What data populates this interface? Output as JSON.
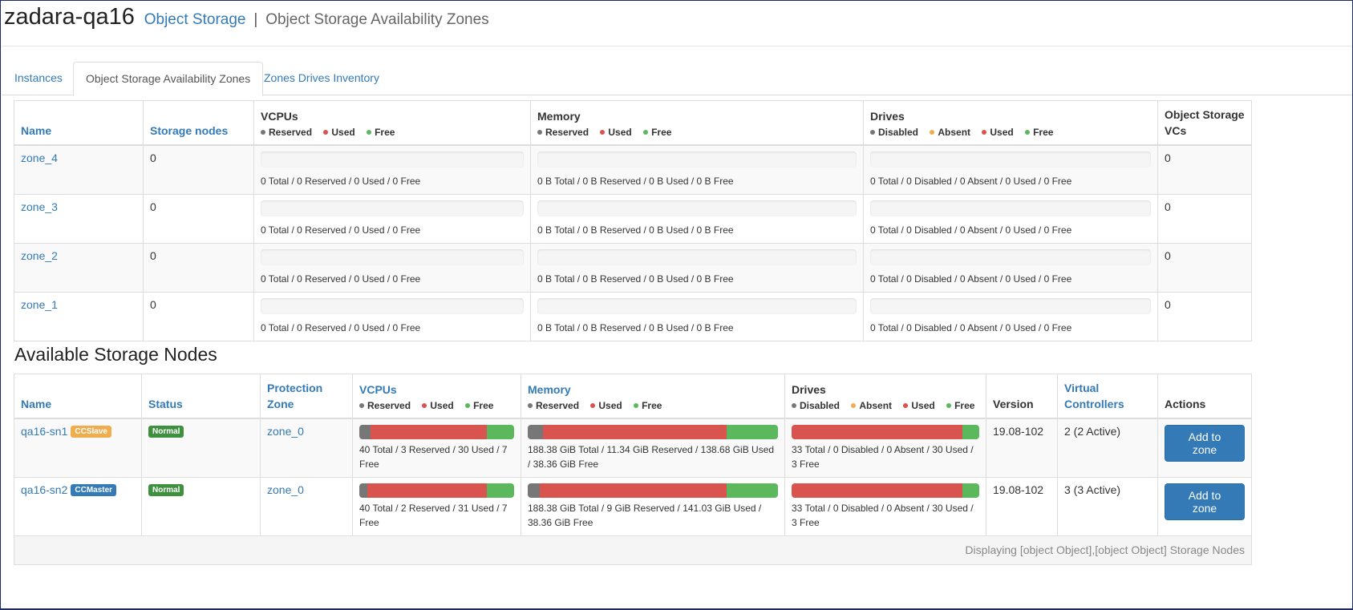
{
  "header": {
    "app_title": "zadara-qa16",
    "crumb_link": "Object Storage",
    "separator": "|",
    "page_title": "Object Storage Availability Zones"
  },
  "tabs": [
    {
      "label": "Instances"
    },
    {
      "label": "Object Storage Availability Zones",
      "active": true
    },
    {
      "label": "Zones Drives Inventory"
    }
  ],
  "zones_table": {
    "headers": {
      "name": "Name",
      "storage_nodes": "Storage nodes",
      "vcpus": "VCPUs",
      "memory": "Memory",
      "drives": "Drives",
      "os_vcs": "Object Storage VCs"
    },
    "legends": {
      "reserved": "Reserved",
      "used": "Used",
      "free": "Free",
      "disabled": "Disabled",
      "absent": "Absent"
    },
    "rows": [
      {
        "name": "zone_4",
        "storage_nodes": "0",
        "vcpus": "0 Total / 0 Reserved / 0 Used / 0 Free",
        "memory": "0 B Total / 0 B Reserved / 0 B Used / 0 B Free",
        "drives": "0 Total / 0 Disabled / 0 Absent / 0 Used / 0 Free",
        "os_vcs": "0"
      },
      {
        "name": "zone_3",
        "storage_nodes": "0",
        "vcpus": "0 Total / 0 Reserved / 0 Used / 0 Free",
        "memory": "0 B Total / 0 B Reserved / 0 B Used / 0 B Free",
        "drives": "0 Total / 0 Disabled / 0 Absent / 0 Used / 0 Free",
        "os_vcs": "0"
      },
      {
        "name": "zone_2",
        "storage_nodes": "0",
        "vcpus": "0 Total / 0 Reserved / 0 Used / 0 Free",
        "memory": "0 B Total / 0 B Reserved / 0 B Used / 0 B Free",
        "drives": "0 Total / 0 Disabled / 0 Absent / 0 Used / 0 Free",
        "os_vcs": "0"
      },
      {
        "name": "zone_1",
        "storage_nodes": "0",
        "vcpus": "0 Total / 0 Reserved / 0 Used / 0 Free",
        "memory": "0 B Total / 0 B Reserved / 0 B Used / 0 B Free",
        "drives": "0 Total / 0 Disabled / 0 Absent / 0 Used / 0 Free",
        "os_vcs": "0"
      }
    ]
  },
  "nodes_section": {
    "title": "Available Storage Nodes",
    "headers": {
      "name": "Name",
      "status": "Status",
      "protection_zone": "Protection Zone",
      "vcpus": "VCPUs",
      "memory": "Memory",
      "drives": "Drives",
      "version": "Version",
      "virtual_controllers": "Virtual Controllers",
      "actions": "Actions"
    },
    "rows": [
      {
        "name": "qa16-sn1",
        "role_badge": "CCSlave",
        "role_color": "#f0ad4e",
        "status": "Normal",
        "status_color": "#3e8f3e",
        "protection_zone": "zone_0",
        "vcpus_summary": "40 Total / 3 Reserved / 30 Used / 7 Free",
        "vcpus_bar": {
          "reserved": 3,
          "used": 30,
          "free": 7
        },
        "memory_summary": "188.38 GiB Total / 11.34 GiB Reserved / 138.68 GiB Used / 38.36 GiB Free",
        "memory_bar": {
          "reserved": 11.34,
          "used": 138.68,
          "free": 38.36
        },
        "drives_summary": "33 Total / 0 Disabled / 0 Absent / 30 Used / 3 Free",
        "drives_bar": {
          "disabled": 0,
          "absent": 0,
          "used": 30,
          "free": 3
        },
        "version": "19.08-102",
        "virtual_controllers": "2 (2 Active)",
        "action": "Add to zone"
      },
      {
        "name": "qa16-sn2",
        "role_badge": "CCMaster",
        "role_color": "#337ab7",
        "status": "Normal",
        "status_color": "#3e8f3e",
        "protection_zone": "zone_0",
        "vcpus_summary": "40 Total / 2 Reserved / 31 Used / 7 Free",
        "vcpus_bar": {
          "reserved": 2,
          "used": 31,
          "free": 7
        },
        "memory_summary": "188.38 GiB Total / 9 GiB Reserved / 141.03 GiB Used / 38.36 GiB Free",
        "memory_bar": {
          "reserved": 9,
          "used": 141.03,
          "free": 38.36
        },
        "drives_summary": "33 Total / 0 Disabled / 0 Absent / 30 Used / 3 Free",
        "drives_bar": {
          "disabled": 0,
          "absent": 0,
          "used": 30,
          "free": 3
        },
        "version": "19.08-102",
        "virtual_controllers": "3 (3 Active)",
        "action": "Add to zone"
      }
    ],
    "footer": "Displaying [object Object],[object Object] Storage Nodes"
  },
  "colors": {
    "reserved": "#777777",
    "used": "#d9534f",
    "free": "#5cb85c",
    "disabled": "#777777",
    "absent": "#f0ad4e",
    "link": "#337ab7"
  }
}
